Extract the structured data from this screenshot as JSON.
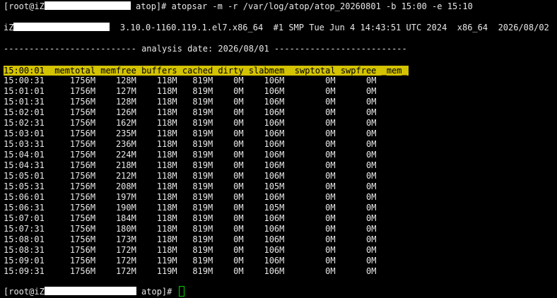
{
  "command_line": {
    "prompt_user": "[root@iZ",
    "prompt_dir": " atop]# ",
    "command": "atopsar -m -r /var/log/atop/atop_20260801 -b 15:00 -e 15:10"
  },
  "system_info": {
    "host_prefix": "iZ",
    "kernel": "3.10.0-1160.119.1.el7.x86_64",
    "build": "#1 SMP Tue Jun 4 14:43:51 UTC 2024",
    "arch": "x86_64",
    "date": "2026/08/02"
  },
  "analysis_line": "-------------------------- analysis date: 2026/08/01 --------------------------",
  "table": {
    "header_text": "15:00:01  memtotal memfree buffers cached dirty slabmem  swptotal swpfree _mem_",
    "columns": [
      "time",
      "memtotal",
      "memfree",
      "buffers",
      "cached",
      "dirty",
      "slabmem",
      "swptotal",
      "swpfree"
    ],
    "rows": [
      [
        "15:00:31",
        "1756M",
        "128M",
        "118M",
        "819M",
        "0M",
        "106M",
        "0M",
        "0M"
      ],
      [
        "15:01:01",
        "1756M",
        "127M",
        "118M",
        "819M",
        "0M",
        "106M",
        "0M",
        "0M"
      ],
      [
        "15:01:31",
        "1756M",
        "128M",
        "118M",
        "819M",
        "0M",
        "106M",
        "0M",
        "0M"
      ],
      [
        "15:02:01",
        "1756M",
        "126M",
        "118M",
        "819M",
        "0M",
        "106M",
        "0M",
        "0M"
      ],
      [
        "15:02:31",
        "1756M",
        "162M",
        "118M",
        "819M",
        "0M",
        "106M",
        "0M",
        "0M"
      ],
      [
        "15:03:01",
        "1756M",
        "235M",
        "118M",
        "819M",
        "0M",
        "106M",
        "0M",
        "0M"
      ],
      [
        "15:03:31",
        "1756M",
        "236M",
        "118M",
        "819M",
        "0M",
        "106M",
        "0M",
        "0M"
      ],
      [
        "15:04:01",
        "1756M",
        "224M",
        "118M",
        "819M",
        "0M",
        "106M",
        "0M",
        "0M"
      ],
      [
        "15:04:31",
        "1756M",
        "218M",
        "118M",
        "819M",
        "0M",
        "106M",
        "0M",
        "0M"
      ],
      [
        "15:05:01",
        "1756M",
        "212M",
        "118M",
        "819M",
        "0M",
        "106M",
        "0M",
        "0M"
      ],
      [
        "15:05:31",
        "1756M",
        "208M",
        "118M",
        "819M",
        "0M",
        "105M",
        "0M",
        "0M"
      ],
      [
        "15:06:01",
        "1756M",
        "197M",
        "118M",
        "819M",
        "0M",
        "106M",
        "0M",
        "0M"
      ],
      [
        "15:06:31",
        "1756M",
        "190M",
        "118M",
        "819M",
        "0M",
        "105M",
        "0M",
        "0M"
      ],
      [
        "15:07:01",
        "1756M",
        "184M",
        "118M",
        "819M",
        "0M",
        "106M",
        "0M",
        "0M"
      ],
      [
        "15:07:31",
        "1756M",
        "180M",
        "118M",
        "819M",
        "0M",
        "106M",
        "0M",
        "0M"
      ],
      [
        "15:08:01",
        "1756M",
        "173M",
        "118M",
        "819M",
        "0M",
        "106M",
        "0M",
        "0M"
      ],
      [
        "15:08:31",
        "1756M",
        "172M",
        "118M",
        "819M",
        "0M",
        "106M",
        "0M",
        "0M"
      ],
      [
        "15:09:01",
        "1756M",
        "172M",
        "119M",
        "819M",
        "0M",
        "106M",
        "0M",
        "0M"
      ],
      [
        "15:09:31",
        "1756M",
        "172M",
        "119M",
        "819M",
        "0M",
        "106M",
        "0M",
        "0M"
      ]
    ]
  },
  "final_prompt": {
    "prompt_user": "[root@iZ",
    "prompt_dir": " atop]# "
  },
  "colors": {
    "background": "#000000",
    "text": "#e8e8e8",
    "header_highlight": "#d4c300",
    "cursor": "#00d000",
    "redaction": "#ffffff"
  }
}
